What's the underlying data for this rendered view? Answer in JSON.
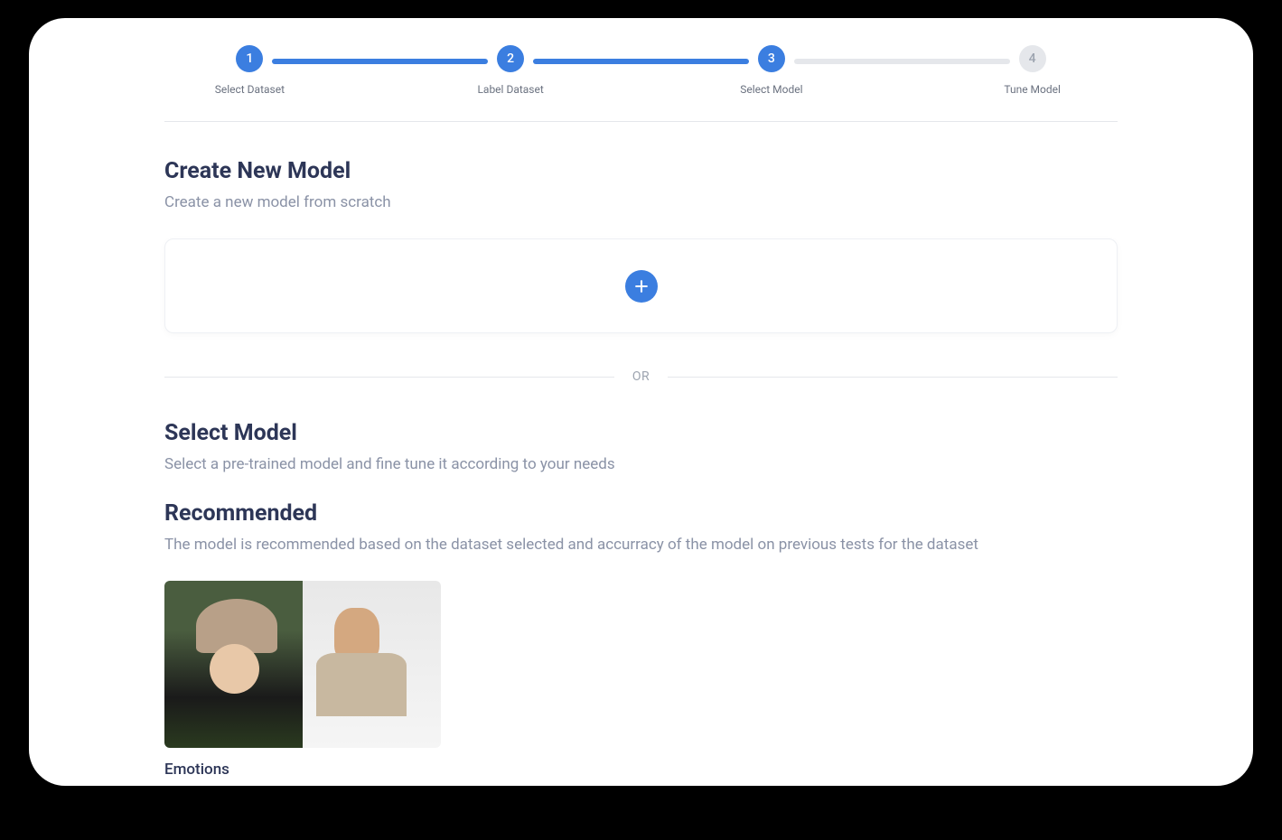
{
  "stepper": {
    "steps": [
      {
        "number": "1",
        "label": "Select Dataset",
        "state": "active"
      },
      {
        "number": "2",
        "label": "Label Dataset",
        "state": "active"
      },
      {
        "number": "3",
        "label": "Select Model",
        "state": "active"
      },
      {
        "number": "4",
        "label": "Tune Model",
        "state": "inactive"
      }
    ]
  },
  "create": {
    "title": "Create New Model",
    "subtitle": "Create a new model from scratch"
  },
  "or_label": "OR",
  "select": {
    "title": "Select Model",
    "subtitle": "Select a pre-trained model and fine tune it according to your needs"
  },
  "recommended": {
    "title": "Recommended",
    "subtitle": "The model is recommended based on the dataset selected and accurracy of the model on previous tests for the dataset"
  },
  "model": {
    "name": "Emotions"
  }
}
